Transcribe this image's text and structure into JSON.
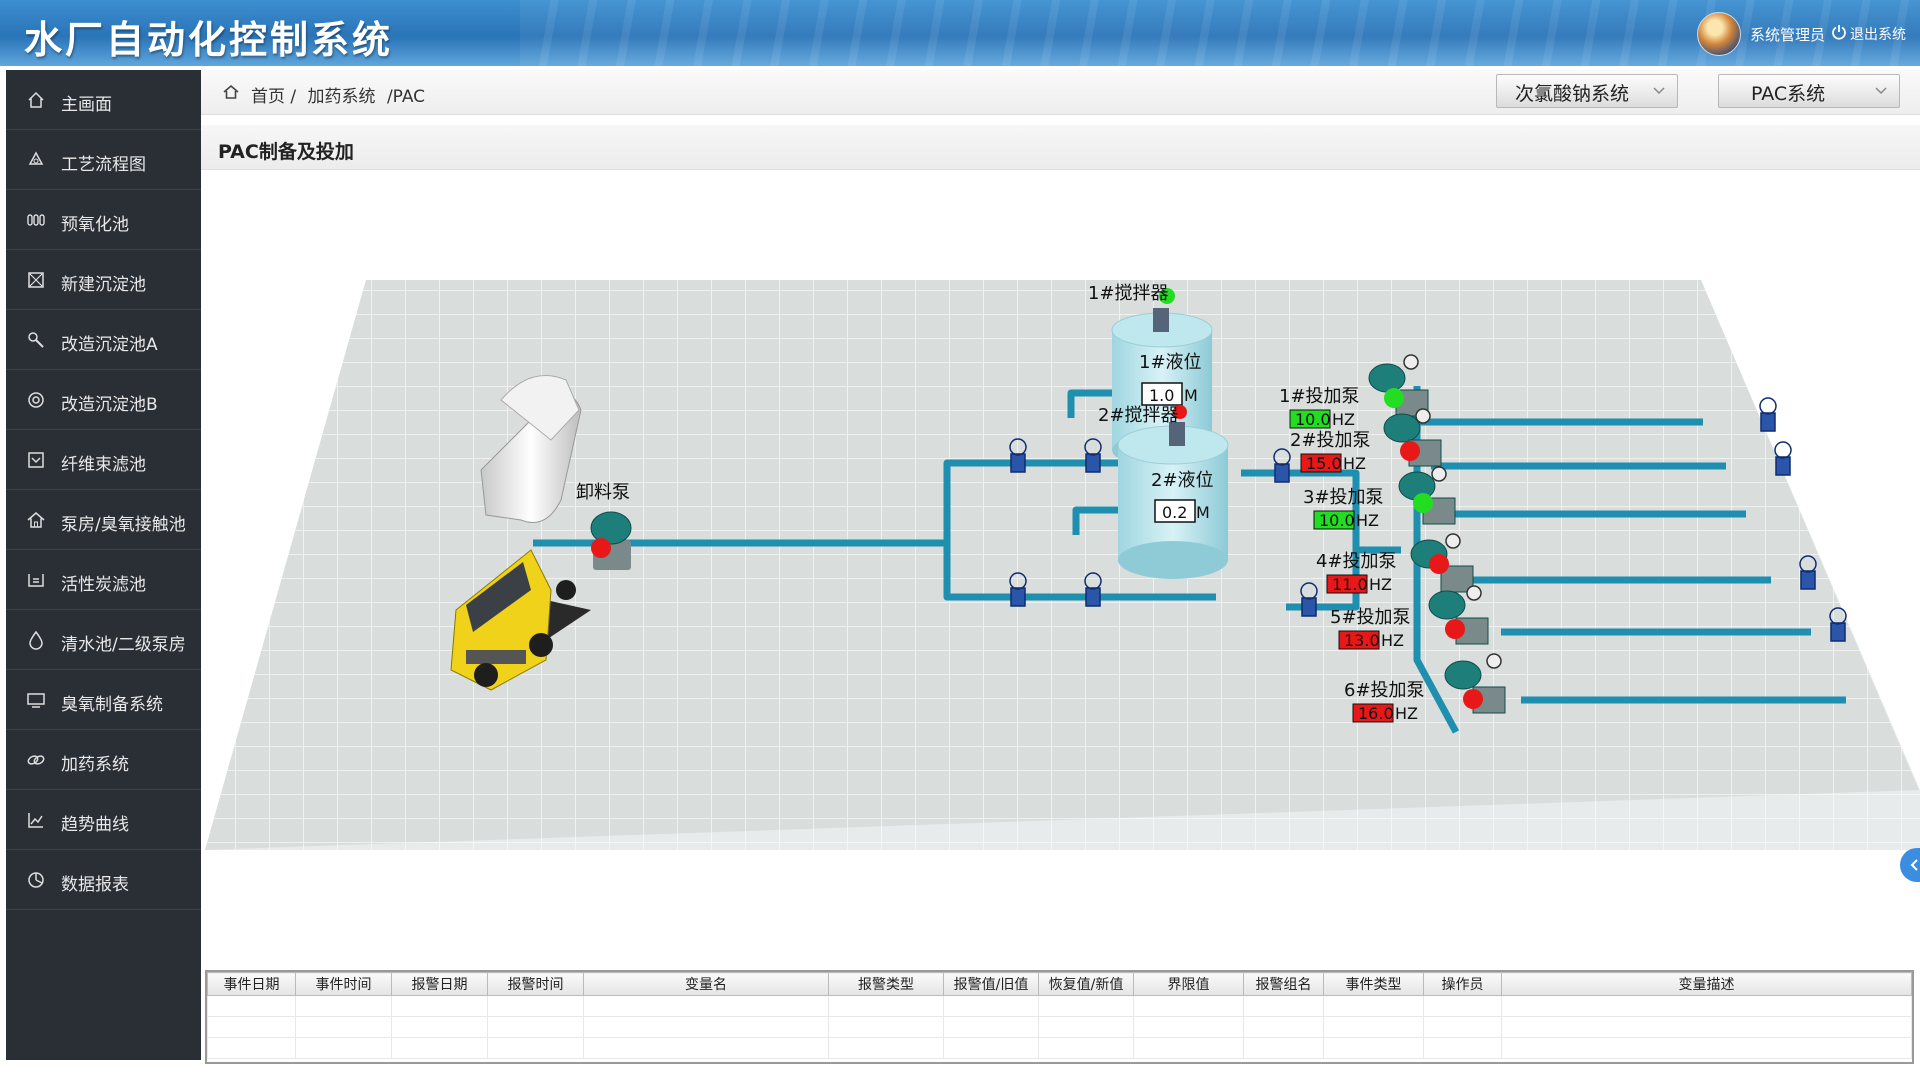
{
  "header": {
    "title": "水厂自动化控制系统",
    "user": "系统管理员",
    "logout": "退出系统"
  },
  "sidebar": {
    "items": [
      {
        "label": "主画面",
        "icon": "home-icon"
      },
      {
        "label": "工艺流程图",
        "icon": "recycle-icon"
      },
      {
        "label": "预氧化池",
        "icon": "tanks-icon"
      },
      {
        "label": "新建沉淀池",
        "icon": "box-x-icon"
      },
      {
        "label": "改造沉淀池A",
        "icon": "wrench-icon"
      },
      {
        "label": "改造沉淀池B",
        "icon": "target-icon"
      },
      {
        "label": "纤维束滤池",
        "icon": "filter-box-icon"
      },
      {
        "label": "泵房/臭氧接触池",
        "icon": "house-icon"
      },
      {
        "label": "活性炭滤池",
        "icon": "tray-icon"
      },
      {
        "label": "清水池/二级泵房",
        "icon": "drop-icon"
      },
      {
        "label": "臭氧制备系统",
        "icon": "monitor-icon"
      },
      {
        "label": "加药系统",
        "icon": "link-icon"
      },
      {
        "label": "趋势曲线",
        "icon": "line-chart-icon"
      },
      {
        "label": "数据报表",
        "icon": "pie-chart-icon"
      }
    ]
  },
  "breadcrumb": {
    "home": "首页 /",
    "level1": "加药系统",
    "level2": "/PAC"
  },
  "selectors": {
    "system1": "次氯酸钠系统",
    "system2": "PAC系统"
  },
  "section": {
    "title": "PAC制备及投加"
  },
  "diagram": {
    "unload_pump": {
      "label": "卸料泵",
      "status": "red"
    },
    "mixer1": {
      "label": "1#搅拌器",
      "status": "green"
    },
    "mixer2": {
      "label": "2#搅拌器",
      "status": "red"
    },
    "level1": {
      "label": "1#液位",
      "value": "1.0",
      "unit": "M"
    },
    "level2": {
      "label": "2#液位",
      "value": "0.2",
      "unit": "M"
    },
    "dosing_pumps": [
      {
        "label": "1#投加泵",
        "value": "10.0",
        "unit": "HZ",
        "status": "green",
        "status_color": "#22dd22"
      },
      {
        "label": "2#投加泵",
        "value": "15.0",
        "unit": "HZ",
        "status": "red",
        "status_color": "#e81818"
      },
      {
        "label": "3#投加泵",
        "value": "10.0",
        "unit": "HZ",
        "status": "green",
        "status_color": "#22dd22"
      },
      {
        "label": "4#投加泵",
        "value": "11.0",
        "unit": "HZ",
        "status": "red",
        "status_color": "#e81818"
      },
      {
        "label": "5#投加泵",
        "value": "13.0",
        "unit": "HZ",
        "status": "red",
        "status_color": "#e81818"
      },
      {
        "label": "6#投加泵",
        "value": "16.0",
        "unit": "HZ",
        "status": "red",
        "status_color": "#e81818"
      }
    ]
  },
  "alarm_table": {
    "columns": [
      "事件日期",
      "事件时间",
      "报警日期",
      "报警时间",
      "变量名",
      "报警类型",
      "报警值/旧值",
      "恢复值/新值",
      "界限值",
      "报警组名",
      "事件类型",
      "操作员",
      "变量描述"
    ],
    "rows": []
  },
  "colors": {
    "pipe": "#1f8fb0",
    "on": "#22dd22",
    "off": "#e81818",
    "sidebar": "#2a2f36"
  }
}
